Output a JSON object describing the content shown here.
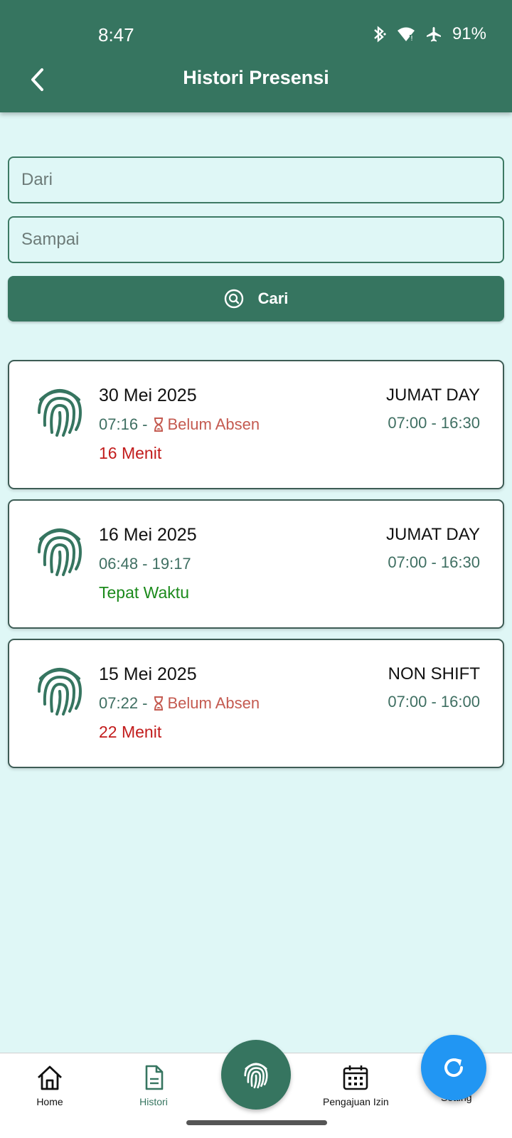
{
  "status_bar": {
    "time": "8:47",
    "battery": "91%"
  },
  "header": {
    "title": "Histori Presensi"
  },
  "filter": {
    "from_placeholder": "Dari",
    "to_placeholder": "Sampai",
    "search_label": "Cari"
  },
  "records": [
    {
      "date": "30 Mei 2025",
      "check_in": "07:16 -",
      "check_out": "Belum Absen",
      "check_out_pending": true,
      "note": "16 Menit",
      "note_status": "late",
      "shift": "JUMAT DAY",
      "shift_time": "07:00 - 16:30"
    },
    {
      "date": "16 Mei 2025",
      "check_in": "06:48 - 19:17",
      "check_out": "",
      "check_out_pending": false,
      "note": "Tepat Waktu",
      "note_status": "ontime",
      "shift": "JUMAT DAY",
      "shift_time": "07:00 - 16:30"
    },
    {
      "date": "15 Mei 2025",
      "check_in": "07:22 -",
      "check_out": "Belum Absen",
      "check_out_pending": true,
      "note": "22 Menit",
      "note_status": "late",
      "shift": "NON SHIFT",
      "shift_time": "07:00 - 16:00"
    }
  ],
  "nav": {
    "home": "Home",
    "histori": "Histori",
    "izin": "Pengajuan Izin",
    "setting": "Setting"
  },
  "icons": {
    "back": "chevron-left-icon",
    "search": "search-icon",
    "fingerprint": "fingerprint-icon",
    "hourglass": "hourglass-icon",
    "refresh": "refresh-icon",
    "home": "home-icon",
    "histori": "document-icon",
    "izin": "calendar-icon"
  },
  "colors": {
    "primary": "#367560",
    "background": "#dff7f6",
    "late": "#c21c1c",
    "ontime": "#1b8a1b",
    "fab": "#2196f3"
  }
}
